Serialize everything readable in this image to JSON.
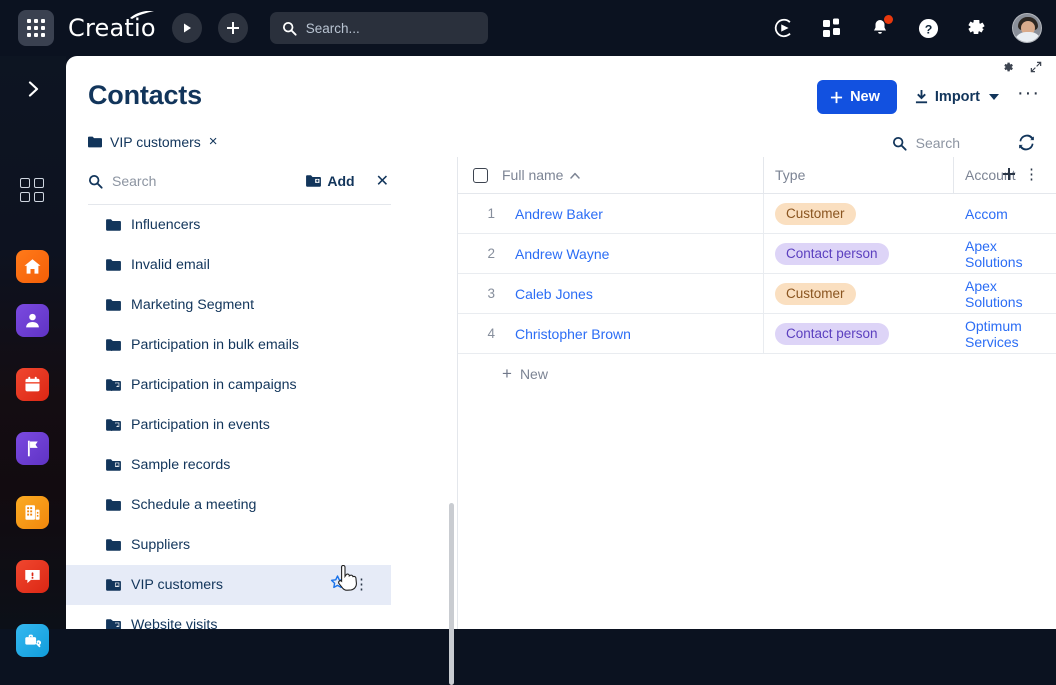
{
  "topbar": {
    "brand": "Creatio",
    "apps_icon": "app-grid-icon",
    "play_icon": "play-icon",
    "plus_icon": "plus-icon",
    "search_placeholder": "Search...",
    "search_value": "",
    "icons": [
      {
        "name": "creatio-ai-icon"
      },
      {
        "name": "apps-tiles-icon"
      },
      {
        "name": "notifications-bell-icon",
        "badge": true
      },
      {
        "name": "help-question-icon"
      },
      {
        "name": "settings-gear-icon"
      }
    ],
    "avatar_name": "user-avatar"
  },
  "rail": {
    "expand_icon": "chevron-right-icon",
    "apps_icon": "workspaces-grid-icon",
    "items": [
      {
        "name": "home",
        "icon": "home-icon",
        "color": "#f5731a"
      },
      {
        "name": "contacts",
        "icon": "person-icon",
        "color": "#6f3fd6"
      },
      {
        "name": "calendar",
        "icon": "calendar-icon",
        "color": "#e8361f"
      },
      {
        "name": "campaigns",
        "icon": "flag-icon",
        "color": "#6f3fd6"
      },
      {
        "name": "accounts",
        "icon": "building-icon",
        "color": "#f59a14"
      },
      {
        "name": "cases",
        "icon": "feedback-icon",
        "color": "#e8361f"
      },
      {
        "name": "service",
        "icon": "service-tools-icon",
        "color": "#25a7e8"
      }
    ]
  },
  "panel": {
    "corner_icons": [
      {
        "name": "page-settings-gear-icon"
      },
      {
        "name": "expand-fullscreen-icon"
      }
    ],
    "title": "Contacts",
    "new_label": "New",
    "import_label": "Import",
    "more_label": "···",
    "chip": {
      "icon": "folder-icon",
      "label": "VIP customers",
      "close": "×"
    },
    "grid_search_placeholder": "Search",
    "grid_search_value": "",
    "refresh_icon": "refresh-icon"
  },
  "folders": {
    "search_placeholder": "Search",
    "search_value": "",
    "add_label": "Add",
    "add_icon": "folder-add-icon",
    "close_icon": "close-icon",
    "items": [
      {
        "label": "Influencers",
        "expandable": false,
        "filtered": false,
        "selected": false
      },
      {
        "label": "Invalid email",
        "expandable": false,
        "filtered": false,
        "selected": false
      },
      {
        "label": "Marketing Segment",
        "expandable": false,
        "filtered": false,
        "selected": false
      },
      {
        "label": "Participation in bulk emails",
        "expandable": true,
        "filtered": false,
        "selected": false
      },
      {
        "label": "Participation in campaigns",
        "expandable": true,
        "filtered": true,
        "selected": false
      },
      {
        "label": "Participation in events",
        "expandable": true,
        "filtered": true,
        "selected": false
      },
      {
        "label": "Sample records",
        "expandable": false,
        "filtered": true,
        "selected": false
      },
      {
        "label": "Schedule a meeting",
        "expandable": false,
        "filtered": false,
        "selected": false
      },
      {
        "label": "Suppliers",
        "expandable": false,
        "filtered": false,
        "selected": false
      },
      {
        "label": "VIP customers",
        "expandable": false,
        "filtered": true,
        "selected": true
      },
      {
        "label": "Website visits",
        "expandable": true,
        "filtered": true,
        "selected": false
      }
    ],
    "star_icon": "favorite-star-icon",
    "kebab_icon": "row-menu-icon"
  },
  "grid": {
    "columns": [
      {
        "key": "name",
        "label": "Full name",
        "sort": "asc"
      },
      {
        "key": "type",
        "label": "Type"
      },
      {
        "key": "account",
        "label": "Account"
      }
    ],
    "add_column_icon": "add-column-icon",
    "column_menu_icon": "column-menu-icon",
    "select_all_checked": false,
    "rows": [
      {
        "index": "1",
        "name": "Andrew Baker",
        "type": "Customer",
        "type_style": "customer",
        "account": "Accom"
      },
      {
        "index": "2",
        "name": "Andrew Wayne",
        "type": "Contact person",
        "type_style": "contact-person",
        "account": "Apex Solutions"
      },
      {
        "index": "3",
        "name": "Caleb Jones",
        "type": "Customer",
        "type_style": "customer",
        "account": "Apex Solutions"
      },
      {
        "index": "4",
        "name": "Christopher Brown",
        "type": "Contact person",
        "type_style": "contact-person",
        "account": "Optimum Services"
      }
    ],
    "new_row_label": "New"
  },
  "colors": {
    "accent_blue": "#1251e0",
    "link_blue": "#2b6df5",
    "title_navy": "#12355b",
    "badge_customer_bg": "#fadfc0",
    "badge_customer_fg": "#8a5520",
    "badge_contact_bg": "#ddd4f7",
    "badge_contact_fg": "#5b3fbf",
    "row_selected_bg": "#e6ebf7",
    "star_blue": "#1a73ea"
  }
}
